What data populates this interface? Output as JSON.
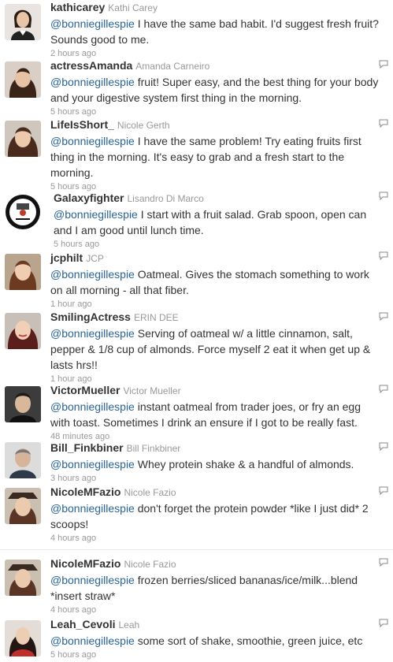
{
  "tweets": [
    {
      "handle": "kathicarey",
      "fullname": "Kathi Carey",
      "mention": "@bonniegillespie",
      "text": " I have the same bad habit. I'd suggest fresh fruit? Sounds good to me.",
      "time": "2 hours ago"
    },
    {
      "handle": "actressAmanda",
      "fullname": "Amanda Carneiro",
      "mention": "@bonniegillespie",
      "text": " fruit! Super easy, and the best thing for your body and your digestive system first thing in the morning.",
      "time": "5 hours ago"
    },
    {
      "handle": "LifeIsShort_",
      "fullname": "Nicole Gerth",
      "mention": "@bonniegillespie",
      "text": " I have the same problem! Try eating fruits first thing in the morning. It's easy to grab and a fresh start to the morning.",
      "time": "5 hours ago"
    },
    {
      "handle": "Galaxyfighter",
      "fullname": "Lisandro Di Marco",
      "mention": "@bonniegillespie",
      "text": " I start with a fruit salad. Grab spoon, open can and I am good until lunch time.",
      "time": "5 hours ago"
    },
    {
      "handle": "jcphilt",
      "fullname": "JCP",
      "mention": "@bonniegillespie",
      "text": " Oatmeal. Gives the stomach something to work on all morning - all that fiber.",
      "time": "1 hour ago"
    },
    {
      "handle": "SmilingActress",
      "fullname": "ERIN DEE",
      "mention": "@bonniegillespie",
      "text": " Serving of oatmeal w/ a little cinnamon, salt, pepper & 1/8 cup of almonds. Force myself 2 eat it when get up & lasts hrs!!",
      "time": "1 hour ago"
    },
    {
      "handle": "VictorMueller",
      "fullname": "Victor Mueller",
      "mention": "@bonniegillespie",
      "text": " instant oatmeal from trader joes, or fry an egg with toast. Sometimes I drink an ensure if I got to be really fast.",
      "time": "48 minutes ago"
    },
    {
      "handle": "Bill_Finkbiner",
      "fullname": "Bill Finkbiner",
      "mention": "@bonniegillespie",
      "text": " Whey protein shake & a handful of almonds.",
      "time": "3 hours ago"
    },
    {
      "handle": "NicoleMFazio",
      "fullname": "Nicole Fazio",
      "mention": "@bonniegillespie",
      "text": " don't forget the protein powder *like I just did* 2 scoops!",
      "time": "4 hours ago"
    },
    {
      "handle": "NicoleMFazio",
      "fullname": "Nicole Fazio",
      "mention": "@bonniegillespie",
      "text": " frozen berries/sliced bananas/ice/milk...blend *insert straw*",
      "time": "4 hours ago"
    },
    {
      "handle": "Leah_Cevoli",
      "fullname": "Leah",
      "mention": "@bonniegillespie",
      "text": " some sort of shake, smoothie, green juice, etc",
      "time": "5 hours ago"
    }
  ]
}
